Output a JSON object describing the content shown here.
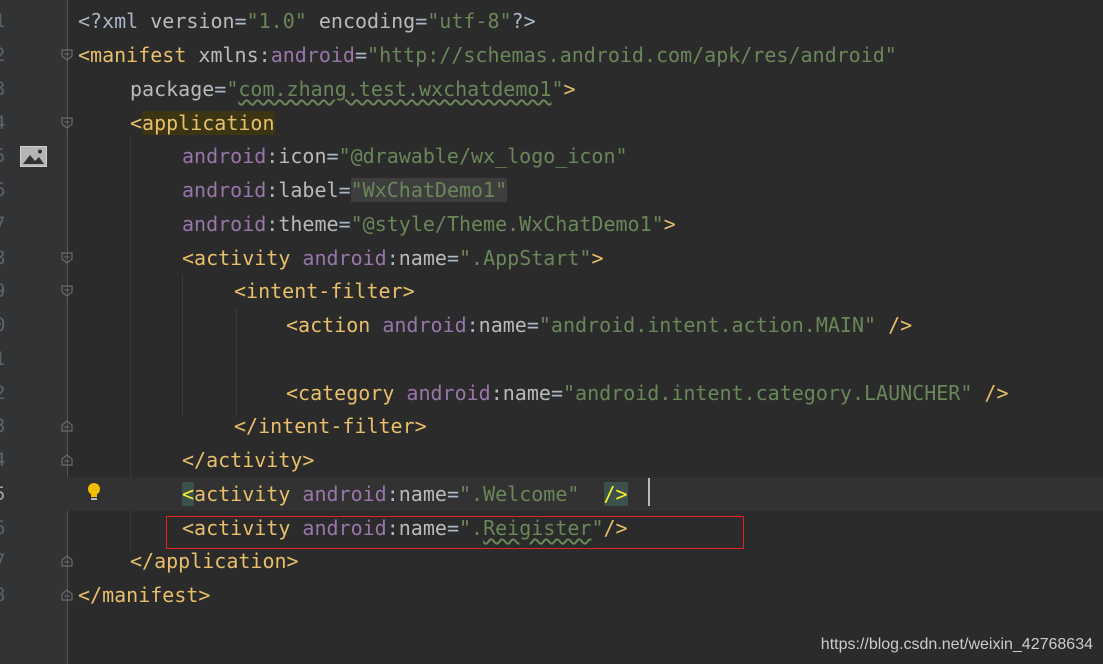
{
  "editor": {
    "language": "xml",
    "file_content_lines": [
      {
        "n": "1",
        "text": "<?xml version=\"1.0\" encoding=\"utf-8\"?>"
      },
      {
        "n": "2",
        "text": "<manifest xmlns:android=\"http://schemas.android.com/apk/res/android\""
      },
      {
        "n": "3",
        "text": "package=\"com.zhang.test.wxchatdemo1\">"
      },
      {
        "n": "4",
        "text": "<application"
      },
      {
        "n": "5",
        "text": "android:icon=\"@drawable/wx_logo_icon\""
      },
      {
        "n": "6",
        "text": "android:label=\"WxChatDemo1\""
      },
      {
        "n": "7",
        "text": "android:theme=\"@style/Theme.WxChatDemo1\">"
      },
      {
        "n": "8",
        "text": "<activity android:name=\".AppStart\">"
      },
      {
        "n": "9",
        "text": "<intent-filter>"
      },
      {
        "n": "0",
        "text": "<action android:name=\"android.intent.action.MAIN\" />"
      },
      {
        "n": "1",
        "text": ""
      },
      {
        "n": "2",
        "text": "<category android:name=\"android.intent.category.LAUNCHER\" />"
      },
      {
        "n": "3",
        "text": "</intent-filter>"
      },
      {
        "n": "4",
        "text": "</activity>"
      },
      {
        "n": "5",
        "text": "<activity android:name=\".Welcome\" />"
      },
      {
        "n": "6",
        "text": "<activity android:name=\".Reigister\"/>"
      },
      {
        "n": "7",
        "text": "</application>"
      },
      {
        "n": "8",
        "text": "</manifest>"
      }
    ],
    "tokens": {
      "xml_decl_open": "<?xml ",
      "version_attr": "version",
      "version_val": "\"1.0\"",
      "encoding_attr": "encoding",
      "encoding_val": "\"utf-8\"",
      "xml_decl_close": "?>",
      "manifest_open": "<manifest ",
      "xmlns_attr": "xmlns",
      "colon": ":",
      "android": "android",
      "eq": "=",
      "schema_val": "\"http://schemas.android.com/apk/res/android\"",
      "package_attr": "package",
      "package_val_q1": "\"",
      "package_val": "com.zhang.test.wxchatdemo1",
      "package_val_q2": "\"",
      "gt": ">",
      "lt": "<",
      "application_tag": "application",
      "icon_attr": "icon",
      "icon_val": "\"@drawable/wx_logo_icon\"",
      "label_attr": "label",
      "label_val": "\"WxChatDemo1\"",
      "theme_attr": "theme",
      "theme_val": "\"@style/Theme.WxChatDemo1\"",
      "activity_open": "<activity ",
      "name_attr": "name",
      "appstart_val": "\".AppStart\"",
      "intent_filter_open": "<intent-filter>",
      "action_open": "<action ",
      "main_val": "\"android.intent.action.MAIN\"",
      "self_close_sp": " />",
      "category_open": "<category ",
      "launcher_val": "\"android.intent.category.LAUNCHER\"",
      "intent_filter_close": "</intent-filter>",
      "activity_close": "</activity>",
      "activity_tag_rest": "activity ",
      "welcome_val": "\".Welcome\"",
      "space": " ",
      "slash_gt": "/>",
      "register_val_q1": "\".",
      "register_val_word": "Reigister",
      "register_val_q2": "\"",
      "application_close": "</application>",
      "manifest_close": "</manifest>"
    }
  },
  "watermark": {
    "text": "https://blog.csdn.net/weixin_42768634"
  },
  "icons": {
    "gutter_image": "image-icon",
    "intention_bulb": "lightbulb-icon",
    "fold": "fold-marker-icon"
  },
  "colors": {
    "background": "#2b2b2b",
    "gutter": "#313335",
    "tag": "#e8bf6a",
    "attribute": "#bababa",
    "namespace": "#9876aa",
    "string": "#6a8759",
    "highlight_box": "#e02424"
  }
}
